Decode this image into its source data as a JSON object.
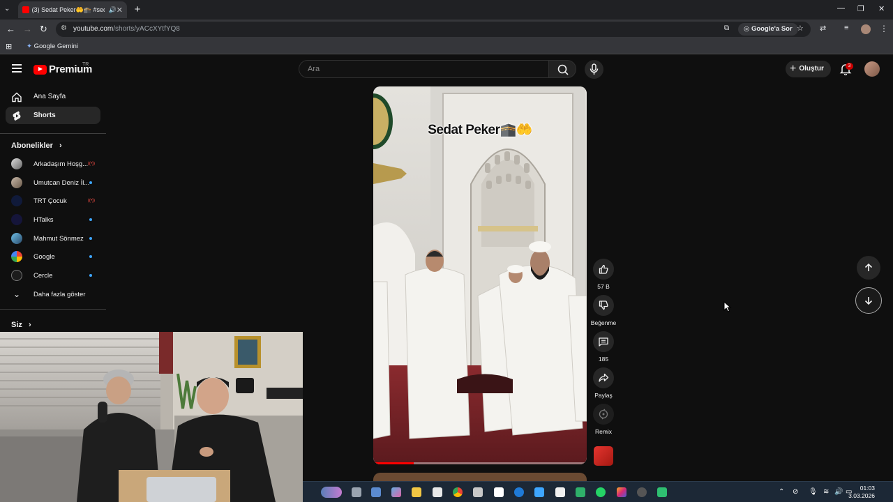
{
  "browser": {
    "tab_title": "(3) Sedat Peker🤲🕋 #sedat",
    "url_host": "youtube.com",
    "url_path": "/shorts/yACcXYtfYQ8",
    "ask_google": "Google'a Sor",
    "bookmark_gemini": "Google Gemini"
  },
  "header": {
    "logo_text": "Premium",
    "logo_region": "TR",
    "search_placeholder": "Ara",
    "create_label": "Oluştur",
    "notification_count": "3"
  },
  "sidebar": {
    "items": [
      {
        "label": "Ana Sayfa",
        "icon": "home-icon"
      },
      {
        "label": "Shorts",
        "icon": "shorts-icon",
        "active": true
      }
    ],
    "subscriptions_title": "Abonelikler",
    "subscriptions": [
      {
        "name": "Arkadaşım Hoşg...",
        "indicator": "live",
        "color": "#8a8a8a"
      },
      {
        "name": "Umutcan Deniz İl...",
        "indicator": "dot",
        "color": "#9c8a7a"
      },
      {
        "name": "TRT Çocuk",
        "indicator": "live",
        "color": "#1a2a5a"
      },
      {
        "name": "HTalks",
        "indicator": "dot",
        "color": "#1a1a3a"
      },
      {
        "name": "Mahmut Sönmez",
        "indicator": "dot",
        "color": "#4a8ab0"
      },
      {
        "name": "Google",
        "indicator": "dot",
        "color": "#ffffff"
      },
      {
        "name": "Cercle",
        "indicator": "dot",
        "color": "#222222"
      }
    ],
    "show_more": "Daha fazla göster",
    "you_title": "Siz"
  },
  "short": {
    "caption": "Sedat Peker🕋🤲",
    "progress": 0.19,
    "actions": {
      "likes": "57 B",
      "dislike": "Beğenme",
      "comments": "185",
      "share": "Paylaş",
      "remix": "Remix"
    }
  },
  "taskbar": {
    "time": "01:03",
    "date": "3.03.2026"
  },
  "colors": {
    "background": "#0f0f0f",
    "brand_red": "#ff0000",
    "chip": "#272727"
  }
}
